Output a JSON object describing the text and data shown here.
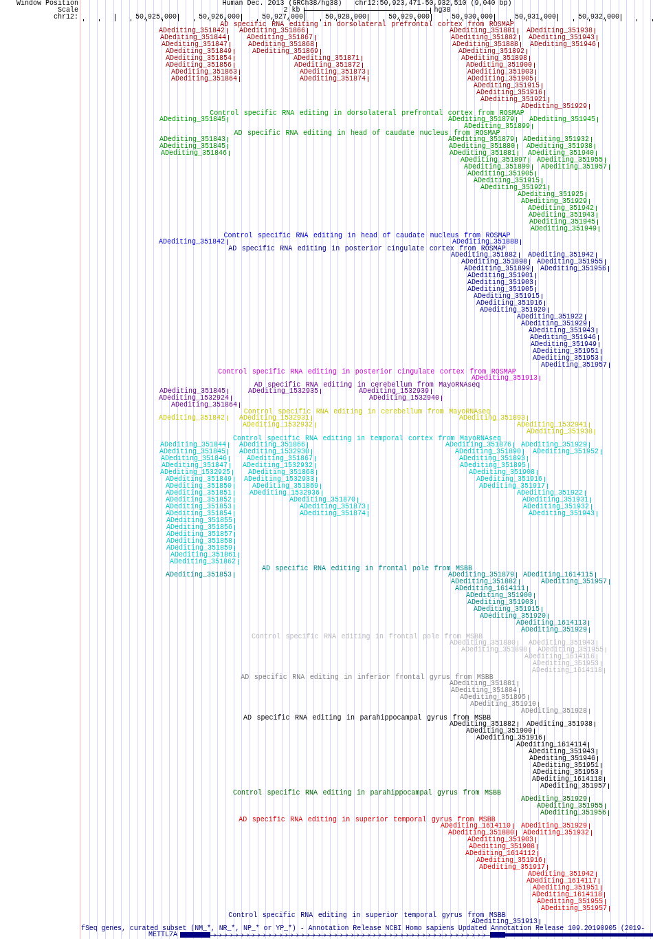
{
  "header": {
    "window_position_label": "Window Position",
    "assembly": "Human Dec. 2013 (GRCh38/hg38)",
    "position": "chr12:50,923,471-50,932,510 (9,040 bp)",
    "scale_label": "Scale",
    "scale_length": "2 kb",
    "scale_assembly": "hg38",
    "chrom_label": "chr12:",
    "ruler_labels": [
      "50,925,000",
      "50,926,000",
      "50,927,000",
      "50,928,000",
      "50,929,000",
      "50,930,000",
      "50,931,000",
      "50,932,000"
    ]
  },
  "tracks": [
    {
      "title": "AD specific RNA editing in dorsolateral prefrontal cortex from ROSMAP",
      "color": "#990000",
      "sites": [
        "ADediting_351842",
        "ADediting_351866",
        "ADediting_351881",
        "ADediting_351938",
        "ADediting_351844",
        "ADediting_351867",
        "ADediting_351882",
        "ADediting_351943",
        "ADediting_351847",
        "ADediting_351868",
        "ADediting_351888",
        "ADediting_351946",
        "ADediting_351849",
        "ADediting_351869",
        "ADediting_351892",
        "ADediting_351854",
        "ADediting_351871",
        "ADediting_351898",
        "ADediting_351856",
        "ADediting_351872",
        "ADediting_351900",
        "ADediting_351863",
        "ADediting_351873",
        "ADediting_351903",
        "ADediting_351864",
        "ADediting_351874",
        "ADediting_351905",
        "ADediting_351915",
        "ADediting_351916",
        "ADediting_351921",
        "ADediting_351929"
      ]
    },
    {
      "title": "Control specific RNA editing in dorsolateral prefrontal cortex from ROSMAP",
      "color": "#00a000",
      "sites": [
        "ADediting_351845",
        "ADediting_351879",
        "ADediting_351945",
        "ADediting_351899"
      ]
    },
    {
      "title": "AD specific RNA editing in head of caudate nucleus from ROSMAP",
      "color": "#009000",
      "sites": [
        "ADediting_351843",
        "ADediting_351879",
        "ADediting_351932",
        "ADediting_351845",
        "ADediting_351880",
        "ADediting_351938",
        "ADediting_351846",
        "ADediting_351881",
        "ADediting_351940",
        "ADediting_351897",
        "ADediting_351955",
        "ADediting_351899",
        "ADediting_351957",
        "ADediting_351905",
        "ADediting_351915",
        "ADediting_351921",
        "ADediting_351925",
        "ADediting_351929",
        "ADediting_351942",
        "ADediting_351943",
        "ADediting_351945",
        "ADediting_351949"
      ]
    },
    {
      "title": "Control specific RNA editing in head of caudate nucleus from ROSMAP",
      "color": "#0000cc",
      "sites": [
        "ADediting_351842",
        "ADediting_351888"
      ]
    },
    {
      "title": "AD specific RNA editing in posterior cingulate cortex from ROSMAP",
      "color": "#000088",
      "sites": [
        "ADediting_351882",
        "ADediting_351942",
        "ADediting_351898",
        "ADediting_351955",
        "ADediting_351899",
        "ADediting_351956",
        "ADediting_351901",
        "ADediting_351903",
        "ADediting_351905",
        "ADediting_351915",
        "ADediting_351916",
        "ADediting_351920",
        "ADediting_351922",
        "ADediting_351929",
        "ADediting_351943",
        "ADediting_351946",
        "ADediting_351949",
        "ADediting_351951",
        "ADediting_351953",
        "ADediting_351957"
      ]
    },
    {
      "title": "Control specific RNA editing in posterior cingulate cortex from ROSMAP",
      "color": "#cc00cc",
      "sites": [
        "ADediting_351913"
      ]
    },
    {
      "title": "AD specific RNA editing in cerebellum from MayoRNAseq",
      "color": "#660088",
      "sites": [
        "ADediting_351845",
        "ADediting_1532935",
        "ADediting_1532939",
        "ADediting_1532924",
        "ADediting_1532940",
        "ADediting_351864"
      ]
    },
    {
      "title": "Control specific RNA editing in cerebellum from MayoRNAseq",
      "color": "#c8c800",
      "sites": [
        "ADediting_351842",
        "ADediting_1532931",
        "ADediting_351893",
        "ADediting_1532932",
        "ADediting_1532941",
        "ADediting_351938"
      ]
    },
    {
      "title": "Control specific RNA editing in temporal cortex from MayoRNAseq",
      "color": "#00c8c8",
      "sites": [
        "ADediting_351844",
        "ADediting_351866",
        "ADediting_351876",
        "ADediting_351929",
        "ADediting_351845",
        "ADediting_1532930",
        "ADediting_351890",
        "ADediting_351952",
        "ADediting_351846",
        "ADediting_351867",
        "ADediting_351893",
        "ADediting_351847",
        "ADediting_1532932",
        "ADediting_351895",
        "ADediting_1532925",
        "ADediting_351868",
        "ADediting_351908",
        "ADediting_351849",
        "ADediting_1532933",
        "ADediting_351916",
        "ADediting_351850",
        "ADediting_351869",
        "ADediting_351917",
        "ADediting_351851",
        "ADediting_1532936",
        "ADediting_351922",
        "ADediting_351852",
        "ADediting_351870",
        "ADediting_351931",
        "ADediting_351853",
        "ADediting_351873",
        "ADediting_351932",
        "ADediting_351854",
        "ADediting_351874",
        "ADediting_351943",
        "ADediting_351855",
        "ADediting_351856",
        "ADediting_351857",
        "ADediting_351858",
        "ADediting_351859",
        "ADediting_351861",
        "ADediting_351862"
      ]
    },
    {
      "title": "AD specific RNA editing in frontal pole from MSBB",
      "color": "#008888",
      "sites": [
        "ADediting_351853",
        "ADediting_351879",
        "ADediting_1614115",
        "ADediting_351882",
        "ADediting_351957",
        "ADediting_1614111",
        "ADediting_351900",
        "ADediting_351903",
        "ADediting_351915",
        "ADediting_351920",
        "ADediting_1614113",
        "ADediting_351929"
      ]
    },
    {
      "title": "Control specific RNA editing in frontal pole from MSBB",
      "color": "#bbbbbb",
      "sites": [
        "ADediting_351880",
        "ADediting_351943",
        "ADediting_351898",
        "ADediting_351955",
        "ADediting_1614116",
        "ADediting_351953",
        "ADediting_1614118"
      ]
    },
    {
      "title": "AD specific RNA editing in inferior frontal gyrus from MSBB",
      "color": "#808080",
      "sites": [
        "ADediting_351881",
        "ADediting_351884",
        "ADediting_351895",
        "ADediting_351910",
        "ADediting_351928"
      ]
    },
    {
      "title": "AD specific RNA editing in parahippocampal gyrus from MSBB",
      "color": "#000000",
      "sites": [
        "ADediting_351882",
        "ADediting_351938",
        "ADediting_351900",
        "ADediting_351916",
        "ADediting_1614114",
        "ADediting_351943",
        "ADediting_351946",
        "ADediting_351951",
        "ADediting_351953",
        "ADediting_1614118",
        "ADediting_351957"
      ]
    },
    {
      "title": "Control specific RNA editing in parahippocampal gyrus from MSBB",
      "color": "#006600",
      "sites": [
        "ADediting_351929",
        "ADediting_351955",
        "ADediting_351956"
      ]
    },
    {
      "title": "AD specific RNA editing in superior temporal gyrus from MSBB",
      "color": "#dd0000",
      "sites": [
        "ADediting_1614110",
        "ADediting_351929",
        "ADediting_351880",
        "ADediting_351932",
        "ADediting_351903",
        "ADediting_351908",
        "ADediting_1614112",
        "ADediting_351916",
        "ADediting_351917",
        "ADediting_351942",
        "ADediting_1614117",
        "ADediting_351951",
        "ADediting_1614118",
        "ADediting_351955",
        "ADediting_351957"
      ]
    },
    {
      "title": "Control specific RNA editing in superior temporal gyrus from MSBB",
      "color": "#000080",
      "sites": [
        "ADediting_351913"
      ]
    }
  ],
  "gene_track": {
    "title": "fSeq genes, curated subset (NM_*, NR_*, NP_* or YP_*) - Annotation Release NCBI Homo sapiens Updated Annotation Release 109.20190905 (2019-",
    "genes": [
      {
        "name": "METTL7A"
      }
    ]
  }
}
